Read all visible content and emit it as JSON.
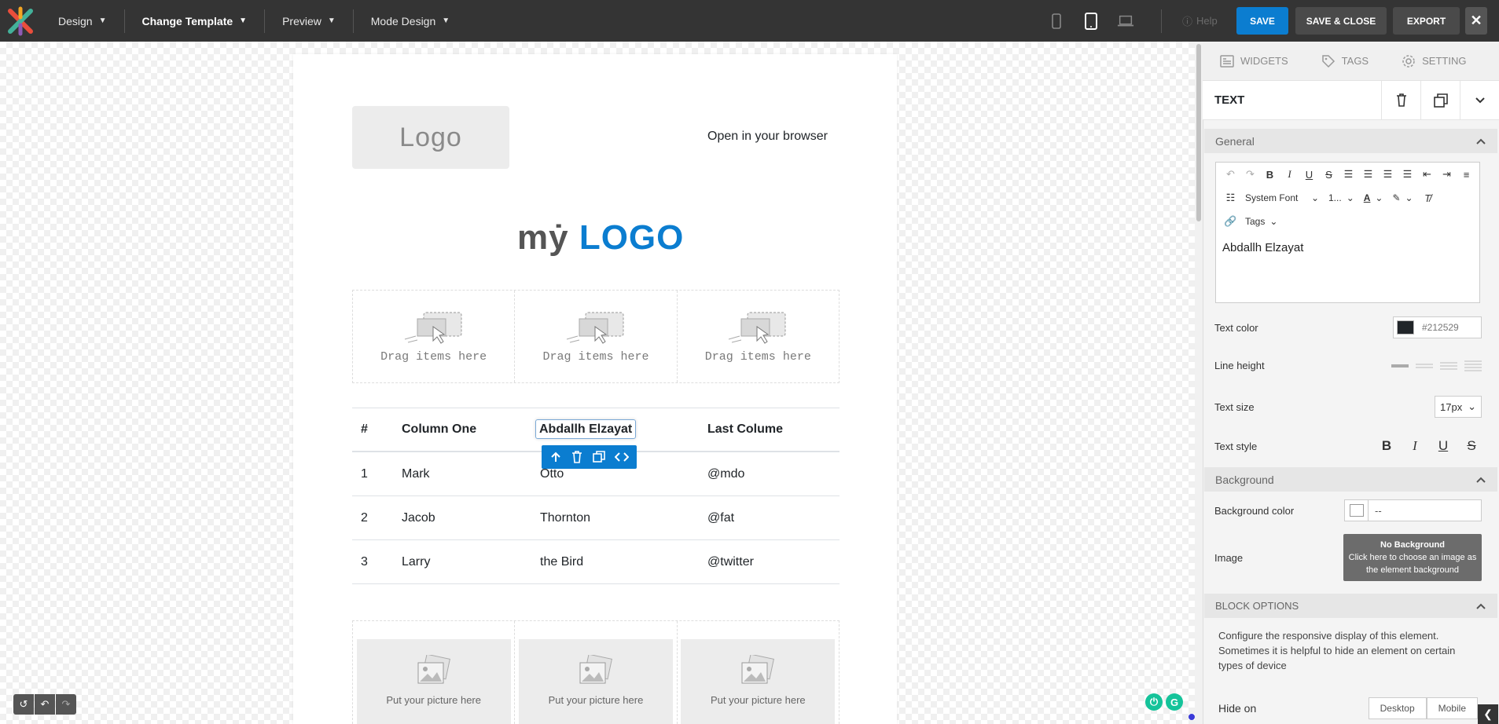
{
  "topbar": {
    "menus": [
      {
        "label": "Design"
      },
      {
        "label": "Change Template"
      },
      {
        "label": "Preview"
      },
      {
        "label": "Mode Design"
      }
    ],
    "help_label": "Help",
    "save_label": "SAVE",
    "save_close_label": "SAVE & CLOSE",
    "export_label": "EXPORT",
    "close_label": "✕",
    "colors": {
      "bar": "#343434",
      "save": "#0b7dd0"
    }
  },
  "email": {
    "logo_placeholder": "Logo",
    "open_browser": "Open in your browser",
    "brand_my": "mẏ",
    "brand_logo": "LOGO",
    "drag_text": [
      "Drag items here",
      "Drag items here",
      "Drag items here"
    ],
    "table": {
      "headers": [
        "#",
        "Column One",
        "Abdallh Elzayat",
        "Last Colume"
      ],
      "rows": [
        [
          "1",
          "Mark",
          "Otto",
          "@mdo"
        ],
        [
          "2",
          "Jacob",
          "Thornton",
          "@fat"
        ],
        [
          "3",
          "Larry",
          "the Bird",
          "@twitter"
        ]
      ]
    },
    "picture_text": [
      "Put your picture here",
      "Put your picture here",
      "Put your picture here"
    ]
  },
  "panel": {
    "tabs": [
      {
        "label": "WIDGETS",
        "icon": "widgets-icon"
      },
      {
        "label": "TAGS",
        "icon": "tag-icon"
      },
      {
        "label": "SETTING",
        "icon": "gear-icon"
      }
    ],
    "section_title": "TEXT",
    "general_label": "General",
    "editor": {
      "font": "System Font",
      "size": "1...",
      "tags": "Tags",
      "content": "Abdallh Elzayat"
    },
    "text_color_label": "Text color",
    "text_color_value": "#212529",
    "line_height_label": "Line height",
    "text_size_label": "Text size",
    "text_size_value": "17px",
    "text_style_label": "Text style",
    "background_label": "Background",
    "bg_color_label": "Background color",
    "bg_color_value": "--",
    "image_label": "Image",
    "no_bg_title": "No Background",
    "no_bg_desc": "Click here to choose an image as the element background",
    "block_options_label": "BLOCK OPTIONS",
    "block_desc": "Configure the responsive display of this element. Sometimes it is helpful to hide an element on certain types of device",
    "hide_on_label": "Hide on",
    "hide_desktop": "Desktop",
    "hide_mobile": "Mobile"
  }
}
